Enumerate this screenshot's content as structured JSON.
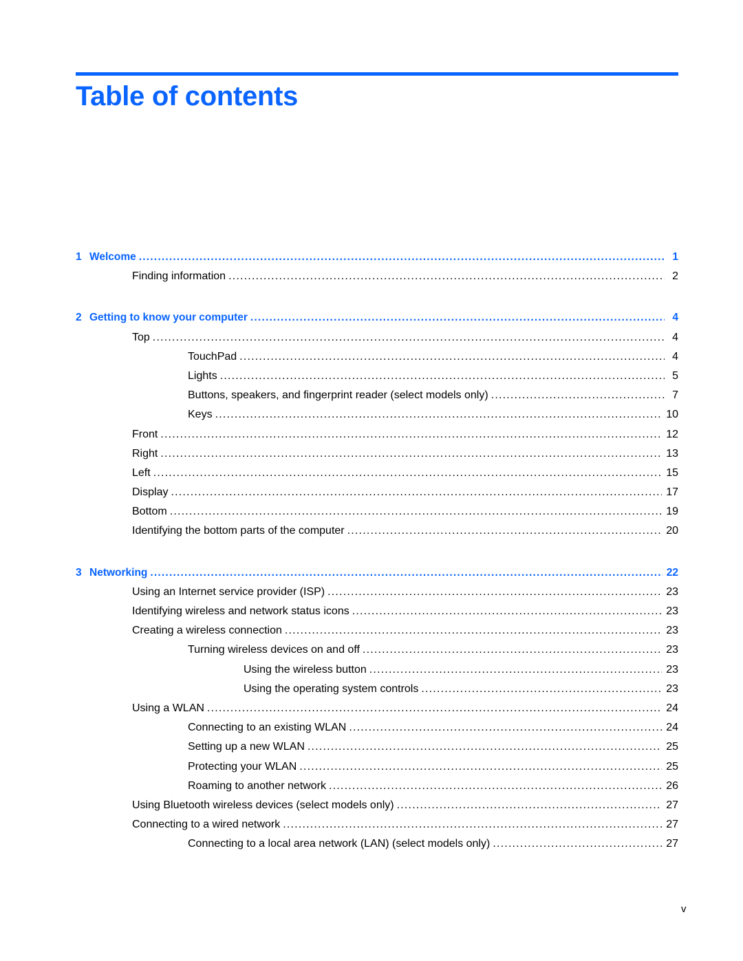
{
  "page": {
    "title": "Table of contents",
    "footer_page_number": "v",
    "accent_color": "#0a64ff"
  },
  "chapters": [
    {
      "number": "1",
      "title": "Welcome",
      "page": "1",
      "entries": [
        {
          "level": 1,
          "title": "Finding information",
          "page": "2"
        }
      ]
    },
    {
      "number": "2",
      "title": "Getting to know your computer",
      "page": "4",
      "entries": [
        {
          "level": 1,
          "title": "Top",
          "page": "4"
        },
        {
          "level": 2,
          "title": "TouchPad",
          "page": "4"
        },
        {
          "level": 2,
          "title": "Lights",
          "page": "5"
        },
        {
          "level": 2,
          "title": "Buttons, speakers, and fingerprint reader (select models only)",
          "page": "7"
        },
        {
          "level": 2,
          "title": "Keys",
          "page": "10"
        },
        {
          "level": 1,
          "title": "Front",
          "page": "12"
        },
        {
          "level": 1,
          "title": "Right",
          "page": "13"
        },
        {
          "level": 1,
          "title": "Left",
          "page": "15"
        },
        {
          "level": 1,
          "title": "Display",
          "page": "17"
        },
        {
          "level": 1,
          "title": "Bottom",
          "page": "19"
        },
        {
          "level": 1,
          "title": "Identifying the bottom parts of the computer",
          "page": "20"
        }
      ]
    },
    {
      "number": "3",
      "title": "Networking",
      "page": "22",
      "entries": [
        {
          "level": 1,
          "title": "Using an Internet service provider (ISP)",
          "page": "23"
        },
        {
          "level": 1,
          "title": "Identifying wireless and network status icons",
          "page": "23"
        },
        {
          "level": 1,
          "title": "Creating a wireless connection",
          "page": "23"
        },
        {
          "level": 2,
          "title": "Turning wireless devices on and off",
          "page": "23"
        },
        {
          "level": 3,
          "title": "Using the wireless button",
          "page": "23"
        },
        {
          "level": 3,
          "title": "Using the operating system controls",
          "page": "23"
        },
        {
          "level": 1,
          "title": "Using a WLAN",
          "page": "24"
        },
        {
          "level": 2,
          "title": "Connecting to an existing WLAN",
          "page": "24"
        },
        {
          "level": 2,
          "title": "Setting up a new WLAN",
          "page": "25"
        },
        {
          "level": 2,
          "title": "Protecting your WLAN",
          "page": "25"
        },
        {
          "level": 2,
          "title": "Roaming to another network",
          "page": "26"
        },
        {
          "level": 1,
          "title": "Using Bluetooth wireless devices (select models only)",
          "page": "27"
        },
        {
          "level": 1,
          "title": "Connecting to a wired network",
          "page": "27"
        },
        {
          "level": 2,
          "title": "Connecting to a local area network (LAN) (select models only)",
          "page": "27"
        }
      ]
    }
  ]
}
